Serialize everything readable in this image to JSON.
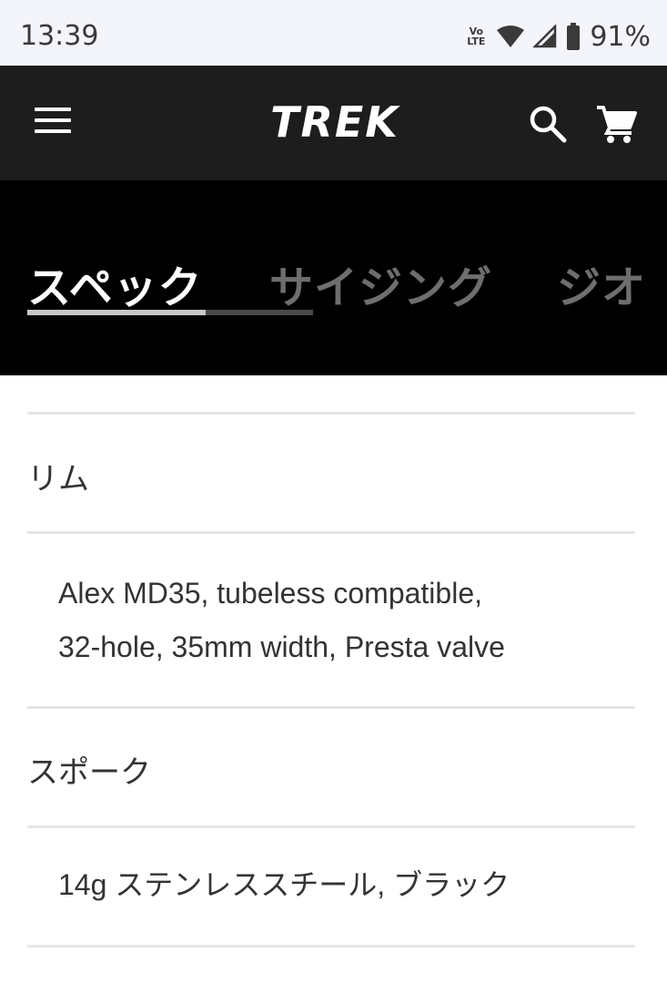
{
  "status_bar": {
    "time": "13:39",
    "volte_top": "Vo",
    "volte_bottom": "LTE",
    "battery": "91%",
    "icons": [
      "volte-icon",
      "wifi-icon",
      "signal-icon",
      "battery-icon"
    ]
  },
  "header": {
    "logo_text": "TREK",
    "icons": [
      "menu-icon",
      "search-icon",
      "cart-icon"
    ]
  },
  "tabs": [
    {
      "label": "スペック",
      "active": true
    },
    {
      "label": "サイジング",
      "active": false
    },
    {
      "label": "ジオ",
      "active": false
    }
  ],
  "specs": [
    {
      "label": "リム",
      "value_lines": [
        "Alex MD35, tubeless compatible,",
        "32-hole, 35mm width, Presta valve"
      ]
    },
    {
      "label": "スポーク",
      "value_lines": [
        "14g ステンレススチール, ブラック"
      ]
    }
  ],
  "colors": {
    "status_bar_bg": "#f4f5fb",
    "header_bg": "#1d1d1d",
    "tab_strip_bg": "#000000",
    "active_tab": "#ffffff",
    "inactive_tab": "#6e6e6e",
    "divider": "#e6e6e6"
  }
}
